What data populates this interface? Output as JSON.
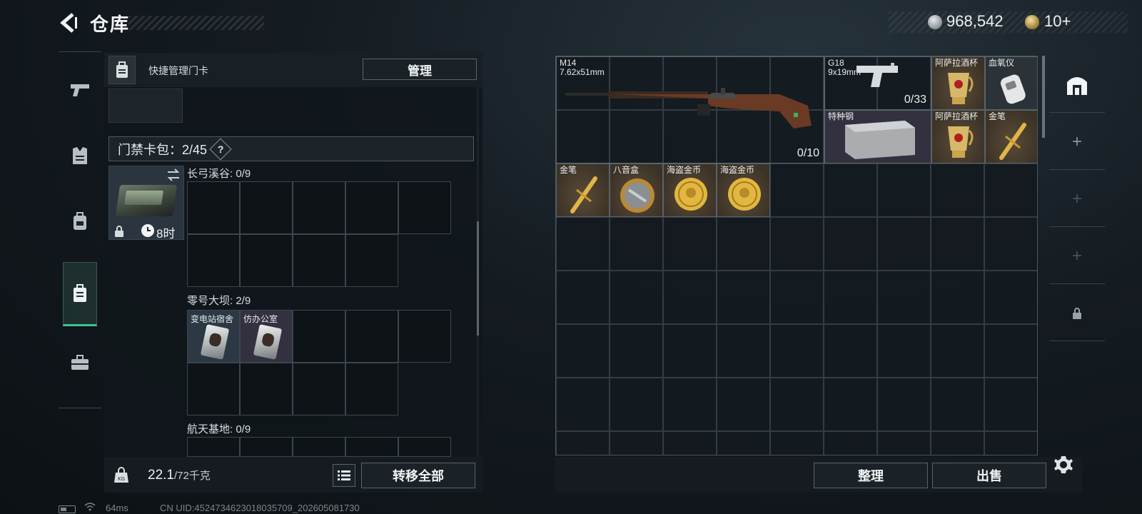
{
  "header": {
    "title": "仓库",
    "coins": "968,542",
    "tickets": "10+"
  },
  "left_panel": {
    "quick_manage_label": "快捷管理门卡",
    "manage_button": "管理",
    "card_pack_label": "门禁卡包：2/45",
    "help_symbol": "?",
    "card_pack_timer": "8时",
    "maps": [
      {
        "label": "长弓溪谷: 0/9",
        "cards": []
      },
      {
        "label": "零号大坝: 2/9",
        "cards": [
          "变电站宿舍",
          "仿办公室"
        ]
      },
      {
        "label": "航天基地: 0/9",
        "cards": []
      }
    ],
    "weight_current": "22.1",
    "weight_max": "/72千克",
    "transfer_all": "转移全部"
  },
  "status_bar": {
    "ping": "64ms",
    "uid": "CN UID:4524734623018035709_202605081730"
  },
  "stash": {
    "items": [
      {
        "name": "M14",
        "sub": "7.62x51mm",
        "ammo": "0/10",
        "kind": "rifle"
      },
      {
        "name": "G18",
        "sub": "9x19mm",
        "ammo": "0/33",
        "kind": "pistol"
      },
      {
        "name": "阿萨拉酒杯",
        "kind": "cup"
      },
      {
        "name": "血氧仪",
        "kind": "oximeter"
      },
      {
        "name": "特种钢",
        "kind": "steel"
      },
      {
        "name": "阿萨拉酒杯",
        "kind": "cup"
      },
      {
        "name": "金笔",
        "kind": "pen"
      },
      {
        "name": "金笔",
        "kind": "pen"
      },
      {
        "name": "八音盒",
        "kind": "musicbox"
      },
      {
        "name": "海盗金币",
        "kind": "coin"
      },
      {
        "name": "海盗金币",
        "kind": "coin"
      }
    ],
    "tidy_button": "整理",
    "sell_button": "出售"
  },
  "side_tabs": [
    "safe-box",
    "add",
    "add",
    "add",
    "locked"
  ],
  "colors": {
    "accent_green": "#3fc38f",
    "gold_item_bg": "#4a3e2f",
    "grey_item_bg": "#2b3238"
  }
}
